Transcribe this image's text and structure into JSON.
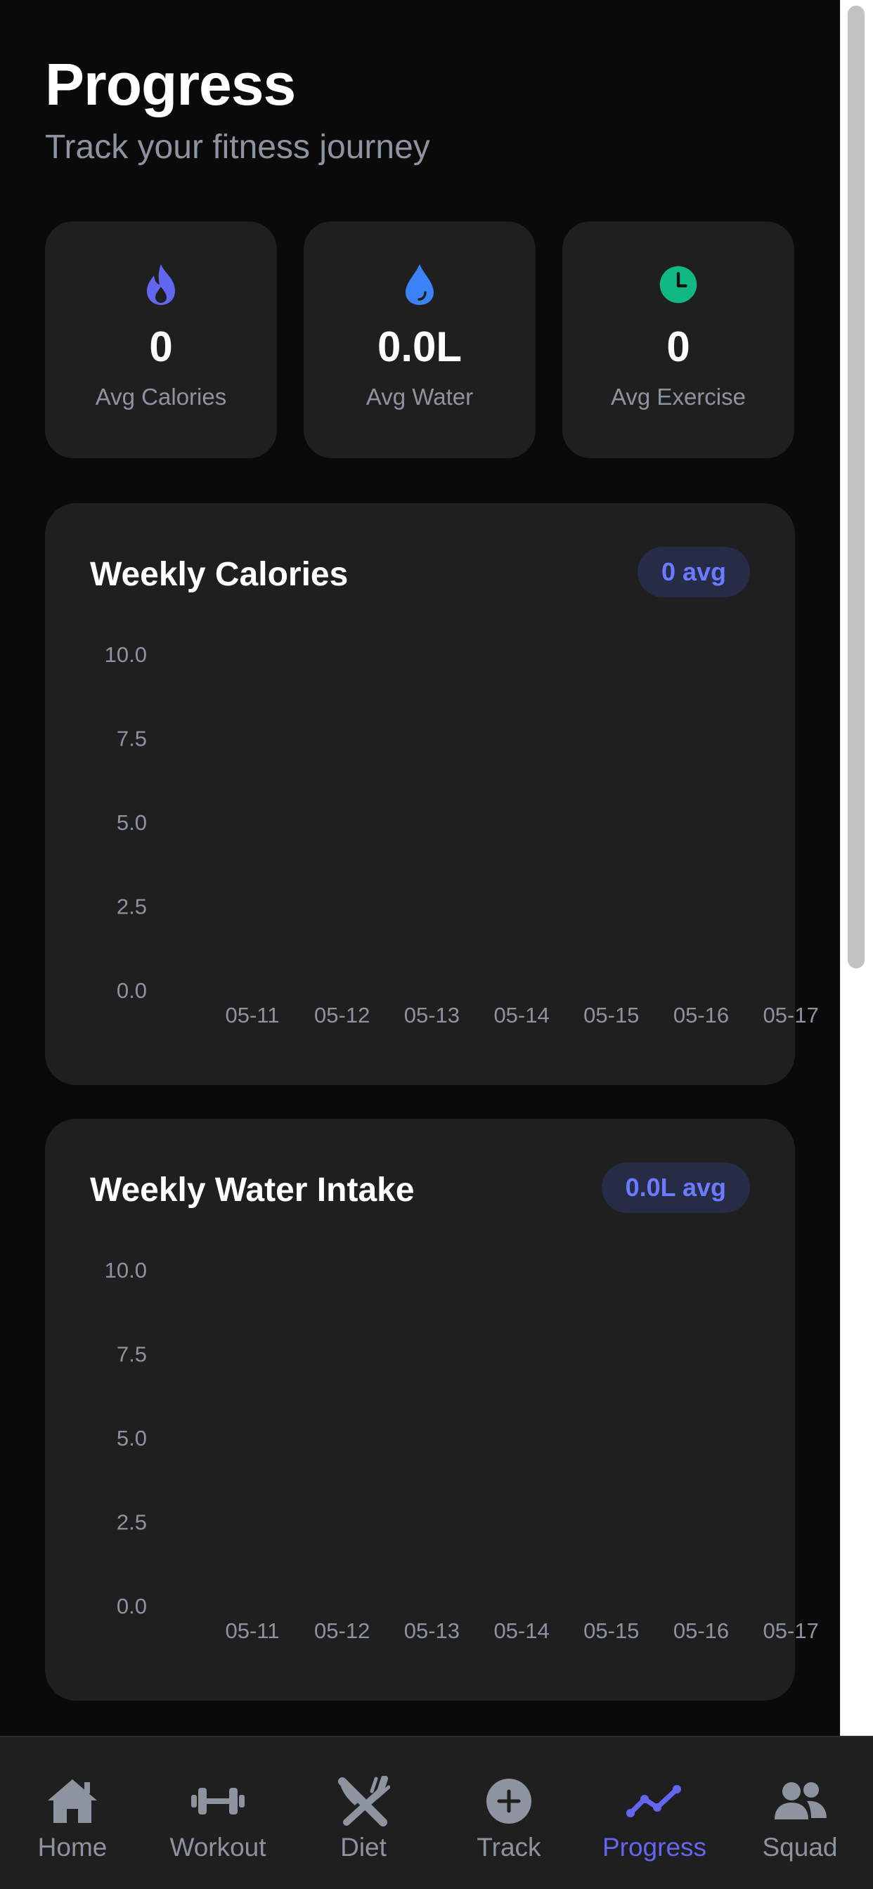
{
  "header": {
    "title": "Progress",
    "subtitle": "Track your fitness journey"
  },
  "stats": [
    {
      "icon": "flame-icon",
      "value": "0",
      "label": "Avg Calories",
      "color": "#6366f1"
    },
    {
      "icon": "water-drop-icon",
      "value": "0.0L",
      "label": "Avg Water",
      "color": "#3b82f6"
    },
    {
      "icon": "clock-icon",
      "value": "0",
      "label": "Avg Exercise",
      "color": "#10b981"
    }
  ],
  "charts": [
    {
      "title": "Weekly Calories",
      "badge": "0 avg"
    },
    {
      "title": "Weekly Water Intake",
      "badge": "0.0L avg"
    }
  ],
  "chart_data": [
    {
      "type": "bar",
      "title": "Weekly Calories",
      "categories": [
        "05-11",
        "05-12",
        "05-13",
        "05-14",
        "05-15",
        "05-16",
        "05-17"
      ],
      "values": [
        0,
        0,
        0,
        0,
        0,
        0,
        0
      ],
      "y_ticks": [
        "0.0",
        "2.5",
        "5.0",
        "7.5",
        "10.0"
      ],
      "ylim": [
        0,
        10
      ],
      "grid": false
    },
    {
      "type": "bar",
      "title": "Weekly Water Intake",
      "categories": [
        "05-11",
        "05-12",
        "05-13",
        "05-14",
        "05-15",
        "05-16",
        "05-17"
      ],
      "values": [
        0,
        0,
        0,
        0,
        0,
        0,
        0
      ],
      "y_ticks": [
        "0.0",
        "2.5",
        "5.0",
        "7.5",
        "10.0"
      ],
      "ylim": [
        0,
        10
      ],
      "grid": false
    }
  ],
  "nav": {
    "active": "Progress",
    "active_color": "#6366f1",
    "items": [
      {
        "icon": "home-icon",
        "label": "Home"
      },
      {
        "icon": "dumbbell-icon",
        "label": "Workout"
      },
      {
        "icon": "utensils-icon",
        "label": "Diet"
      },
      {
        "icon": "plus-circle-icon",
        "label": "Track"
      },
      {
        "icon": "trend-line-icon",
        "label": "Progress"
      },
      {
        "icon": "users-icon",
        "label": "Squad"
      }
    ]
  }
}
